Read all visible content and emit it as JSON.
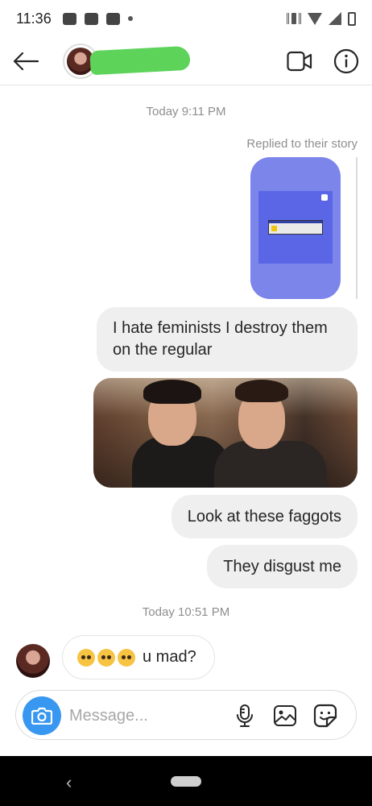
{
  "status_bar": {
    "time": "11:36"
  },
  "header": {
    "back_label": "←"
  },
  "messages": {
    "timestamp_1": "Today 9:11 PM",
    "reply_note": "Replied to their story",
    "out_1": "I hate feminists I destroy them on the regular",
    "out_2": "Look at these faggots",
    "out_3": "They disgust me",
    "timestamp_2": "Today 10:51 PM",
    "in_1_text": "u mad?"
  },
  "composer": {
    "placeholder": "Message..."
  },
  "nav": {
    "back": "‹"
  },
  "colors": {
    "accent": "#3897f0",
    "bubble": "#efefef",
    "story": "#7b85ea",
    "redaction": "#5dd35a"
  }
}
